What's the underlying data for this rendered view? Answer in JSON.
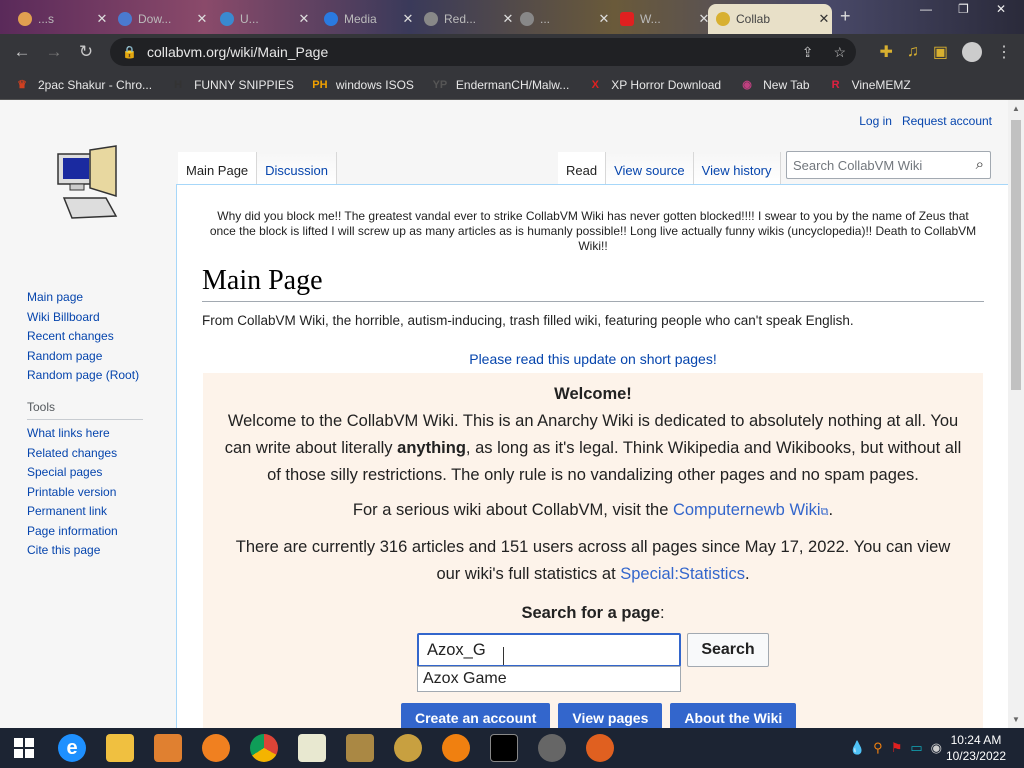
{
  "browser": {
    "tabs": [
      {
        "label": "...s",
        "color": "#e0a050"
      },
      {
        "label": "Dow...",
        "color": "#4a7ad0"
      },
      {
        "label": "U...",
        "color": "#3a8ad0"
      },
      {
        "label": "Media",
        "color": "#2a7ae0"
      },
      {
        "label": "Red...",
        "color": "#888"
      },
      {
        "label": "...",
        "color": "#888"
      },
      {
        "label": "W...",
        "color": "#e02020"
      },
      {
        "label": "Collab",
        "color": "#d8b030"
      }
    ],
    "url": "collabvm.org/wiki/Main_Page",
    "bookmarks": [
      {
        "label": "2pac Shakur - Chro...",
        "icon": "2pac-icon",
        "color": "#d04020",
        "glyph": "♛"
      },
      {
        "label": "FUNNY SNIPPIES",
        "icon": "h-icon",
        "color": "#333",
        "glyph": "H"
      },
      {
        "label": "windows ISOS",
        "icon": "ph-icon",
        "color": "#f0a000",
        "glyph": "PH"
      },
      {
        "label": "EndermanCH/Malw...",
        "icon": "yp-icon",
        "color": "#555",
        "glyph": "YP"
      },
      {
        "label": "XP Horror Download",
        "icon": "x-icon",
        "color": "#e02020",
        "glyph": "X"
      },
      {
        "label": "New Tab",
        "icon": "newtab-icon",
        "color": "#c04080",
        "glyph": "◉"
      },
      {
        "label": "VineMEMZ",
        "icon": "r-icon",
        "color": "#e02040",
        "glyph": "R"
      }
    ]
  },
  "wiki": {
    "personal": {
      "login": "Log in",
      "request": "Request account"
    },
    "tabs_left": {
      "main": "Main Page",
      "discussion": "Discussion"
    },
    "tabs_right": {
      "read": "Read",
      "source": "View source",
      "history": "View history"
    },
    "search_placeholder": "Search CollabVM Wiki",
    "sitenotice": "Why did you block me!! The greatest vandal ever to strike CollabVM Wiki has never gotten blocked!!!! I swear to you by the name of Zeus that once the block is lifted I will screw up as many articles as is humanly possible!! Long live actually funny wikis (uncyclopedia)!! Death to CollabVM Wiki!!",
    "title": "Main Page",
    "tagline": "From CollabVM Wiki, the horrible, autism-inducing, trash filled wiki, featuring people who can't speak English.",
    "notice_link": "Please read this update on short pages!",
    "welcome": {
      "title": "Welcome!",
      "p1a": "Welcome to the CollabVM Wiki. This is an Anarchy Wiki is dedicated to absolutely nothing at all. You can write about literally ",
      "p1b": "anything",
      "p1c": ", as long as it's legal. Think Wikipedia and Wikibooks, but without all of those silly restrictions. The only rule is no vandalizing other pages and no spam pages.",
      "p2a": "For a serious wiki about CollabVM, visit the ",
      "p2link": "Computernewb Wiki",
      "p2b": ".",
      "p3a": "There are currently 316 articles and 151 users across all pages since May 17, 2022. You can view our wiki's full statistics at ",
      "p3link": "Special:Statistics",
      "p3b": ".",
      "search_label": "Search for a page",
      "search_colon": ":",
      "search_value": "Azox_G",
      "search_button": "Search",
      "suggestion": "Azox Game",
      "buttons": {
        "create": "Create an account",
        "view": "View pages",
        "about": "About the Wiki"
      }
    },
    "nav": [
      "Main page",
      "Wiki Billboard",
      "Recent changes",
      "Random page",
      "Random page (Root)"
    ],
    "tools_heading": "Tools",
    "tools": [
      "What links here",
      "Related changes",
      "Special pages",
      "Printable version",
      "Permanent link",
      "Page information",
      "Cite this page"
    ]
  },
  "taskbar": {
    "time": "10:24 AM",
    "date": "10/23/2022"
  }
}
